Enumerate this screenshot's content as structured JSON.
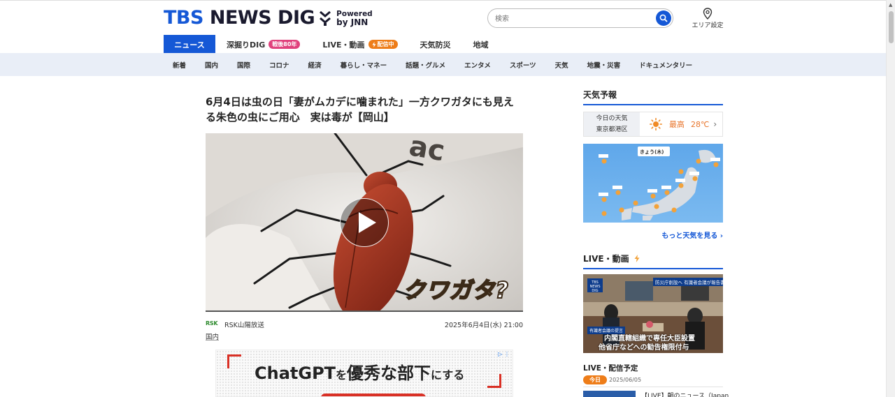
{
  "header": {
    "logo_part1": "TBS",
    "logo_part2": "NEWS DIG",
    "powered": "Powered",
    "by": "by JNN",
    "search_placeholder": "検索",
    "area_label": "エリア設定"
  },
  "main_nav": [
    {
      "label": "ニュース",
      "active": true
    },
    {
      "label": "深掘りDIG",
      "badge": "戦後80年"
    },
    {
      "label": "LIVE・動画",
      "badge": "配信中"
    },
    {
      "label": "天気防災"
    },
    {
      "label": "地域"
    }
  ],
  "sub_nav": [
    "新着",
    "国内",
    "国際",
    "コロナ",
    "経済",
    "暮らし・マネー",
    "話題・グルメ",
    "エンタメ",
    "スポーツ",
    "天気",
    "地震・災害",
    "ドキュメンタリー"
  ],
  "article": {
    "headline": "6月4日は虫の日「妻がムカデに噛まれた」一方クワガタにも見える朱色の虫にご用心　実は毒が【岡山】",
    "video_caption": "クワガタ?",
    "source_logo": "RSK",
    "source": "RSK山陽放送",
    "date": "2025年6月4日(水) 21:00",
    "category": "国内"
  },
  "ad": {
    "title_main": "ChatGPT",
    "title_wo": "を",
    "title_rest": "優秀な部下",
    "title_end": "にする"
  },
  "sidebar": {
    "weather": {
      "title": "天気予報",
      "today_label": "今日の天気",
      "location": "東京都港区",
      "highest_label": "最高",
      "highest_temp": "28℃",
      "more_link": "もっと天気を見る ›",
      "map_label": "きょう(木)"
    },
    "live": {
      "title": "LIVE・動画",
      "thumb_tag": "防災庁創設へ 有識者会議が報告書",
      "thumb_tag2": "有識者会議の提言",
      "thumb_caption1": "内閣直轄組織で専任大臣設置",
      "thumb_caption2": "他省庁などへの勧告権限付与",
      "logo_text": "TBS NEWS DIG"
    },
    "schedule": {
      "title": "LIVE・配信予定",
      "today_tag": "今日",
      "date": "2025/06/05",
      "item_text": "【LIVE】朝のニュース（Japan"
    }
  },
  "colors": {
    "brand_blue": "#1558d6",
    "badge_pink": "#e0417c",
    "badge_orange": "#ee7d19",
    "subnav_bg": "#e9eef7"
  }
}
